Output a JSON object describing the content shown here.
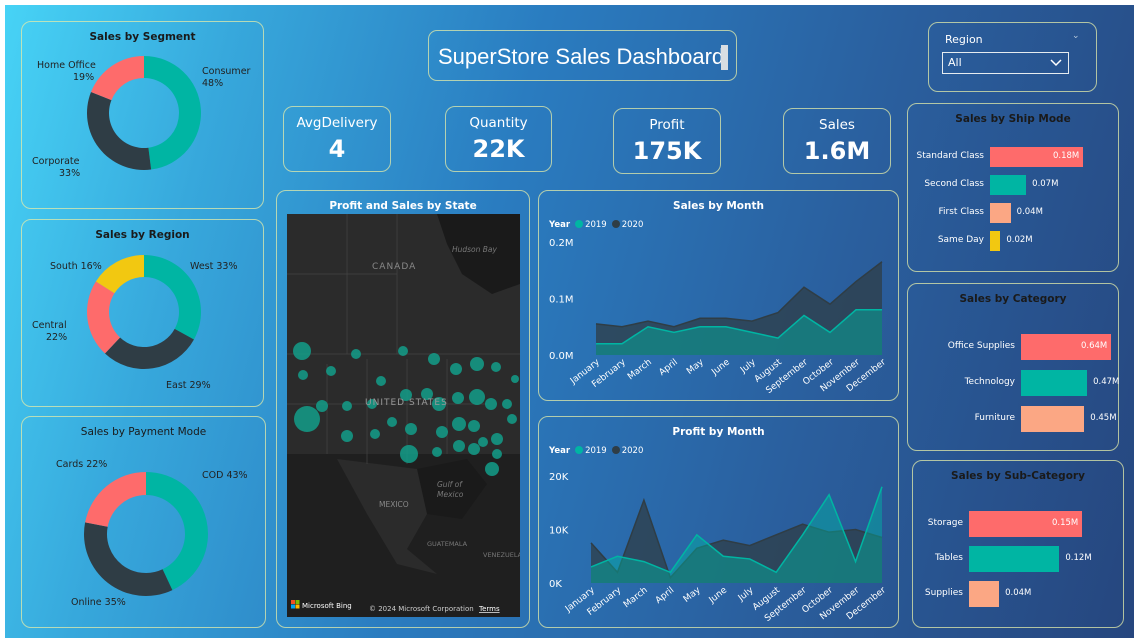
{
  "header": {
    "title": "SuperStore Sales Dashboard"
  },
  "filter": {
    "label": "Region",
    "value": "All"
  },
  "kpis": [
    {
      "label": "AvgDelivery",
      "value": "4"
    },
    {
      "label": "Quantity",
      "value": "22K"
    },
    {
      "label": "Profit",
      "value": "175K"
    },
    {
      "label": "Sales",
      "value": "1.6M"
    }
  ],
  "colors": {
    "teal": "#00b5a3",
    "dark": "#2f3d45",
    "coral": "#fe6b6b",
    "yellow": "#f2c811",
    "peach": "#fba784"
  },
  "donuts": {
    "segment": {
      "title": "Sales by Segment",
      "labels": [
        {
          "name": "Consumer",
          "pct": "48%"
        },
        {
          "name": "Corporate",
          "pct": "33%"
        },
        {
          "name": "Home Office",
          "pct": "19%"
        }
      ]
    },
    "region": {
      "title": "Sales by Region",
      "labels": [
        "West 33%",
        "East 29%",
        "Central",
        "22%",
        "South 16%"
      ]
    },
    "payment": {
      "title": "Sales by Payment Mode",
      "labels": [
        "COD 43%",
        "Online 35%",
        "Cards 22%"
      ]
    }
  },
  "map": {
    "title": "Profit and Sales by State",
    "labels": [
      "CANADA",
      "UNITED STATES",
      "MEXICO",
      "Hudson Bay",
      "Gulf of",
      "Mexico",
      "GUATEMALA",
      "VENEZUELA"
    ],
    "brand": "Microsoft Bing",
    "copyright": "© 2024 Microsoft Corporation",
    "terms": "Terms"
  },
  "legend": {
    "title": "Year",
    "items": [
      "2019",
      "2020"
    ]
  },
  "ship_mode": {
    "title": "Sales by Ship Mode"
  },
  "category": {
    "title": "Sales by Category"
  },
  "subcategory": {
    "title": "Sales by Sub-Category"
  },
  "chart_data": [
    {
      "type": "pie",
      "title": "Sales by Segment",
      "categories": [
        "Consumer",
        "Corporate",
        "Home Office"
      ],
      "values": [
        48,
        33,
        19
      ]
    },
    {
      "type": "pie",
      "title": "Sales by Region",
      "categories": [
        "West",
        "East",
        "Central",
        "South"
      ],
      "values": [
        33,
        29,
        22,
        16
      ]
    },
    {
      "type": "pie",
      "title": "Sales by Payment Mode",
      "categories": [
        "COD",
        "Online",
        "Cards"
      ],
      "values": [
        43,
        35,
        22
      ]
    },
    {
      "type": "bar",
      "title": "Sales by Ship Mode",
      "categories": [
        "Standard Class",
        "Second Class",
        "First Class",
        "Same Day"
      ],
      "values": [
        0.18,
        0.07,
        0.04,
        0.02
      ],
      "value_labels": [
        "0.18M",
        "0.07M",
        "0.04M",
        "0.02M"
      ]
    },
    {
      "type": "bar",
      "title": "Sales by Category",
      "categories": [
        "Office Supplies",
        "Technology",
        "Furniture"
      ],
      "values": [
        0.64,
        0.47,
        0.45
      ],
      "value_labels": [
        "0.64M",
        "0.47M",
        "0.45M"
      ]
    },
    {
      "type": "bar",
      "title": "Sales by Sub-Category",
      "categories": [
        "Storage",
        "Tables",
        "Supplies"
      ],
      "values": [
        0.15,
        0.12,
        0.04
      ],
      "value_labels": [
        "0.15M",
        "0.12M",
        "0.04M"
      ]
    },
    {
      "type": "area",
      "title": "Sales by Month",
      "categories": [
        "January",
        "February",
        "March",
        "April",
        "May",
        "June",
        "July",
        "August",
        "September",
        "October",
        "November",
        "December"
      ],
      "yticks": [
        "0.0M",
        "0.1M",
        "0.2M"
      ],
      "ylim": [
        0,
        0.2
      ],
      "series": [
        {
          "name": "2019",
          "values": [
            0.02,
            0.02,
            0.05,
            0.04,
            0.05,
            0.05,
            0.04,
            0.03,
            0.07,
            0.04,
            0.08,
            0.08
          ]
        },
        {
          "name": "2020",
          "values": [
            0.055,
            0.05,
            0.06,
            0.05,
            0.065,
            0.065,
            0.06,
            0.075,
            0.12,
            0.09,
            0.13,
            0.165
          ]
        }
      ]
    },
    {
      "type": "area",
      "title": "Profit by Month",
      "categories": [
        "January",
        "February",
        "March",
        "April",
        "May",
        "June",
        "July",
        "August",
        "September",
        "October",
        "November",
        "December"
      ],
      "yticks": [
        "0K",
        "10K",
        "20K"
      ],
      "ylim": [
        0,
        20000
      ],
      "series": [
        {
          "name": "2019",
          "values": [
            3000,
            5000,
            4000,
            2000,
            9000,
            5000,
            4500,
            2000,
            9000,
            16500,
            4000,
            18000
          ]
        },
        {
          "name": "2020",
          "values": [
            7500,
            2000,
            15500,
            1000,
            6500,
            8000,
            7000,
            9000,
            11000,
            9500,
            10000,
            8500
          ]
        }
      ]
    }
  ]
}
